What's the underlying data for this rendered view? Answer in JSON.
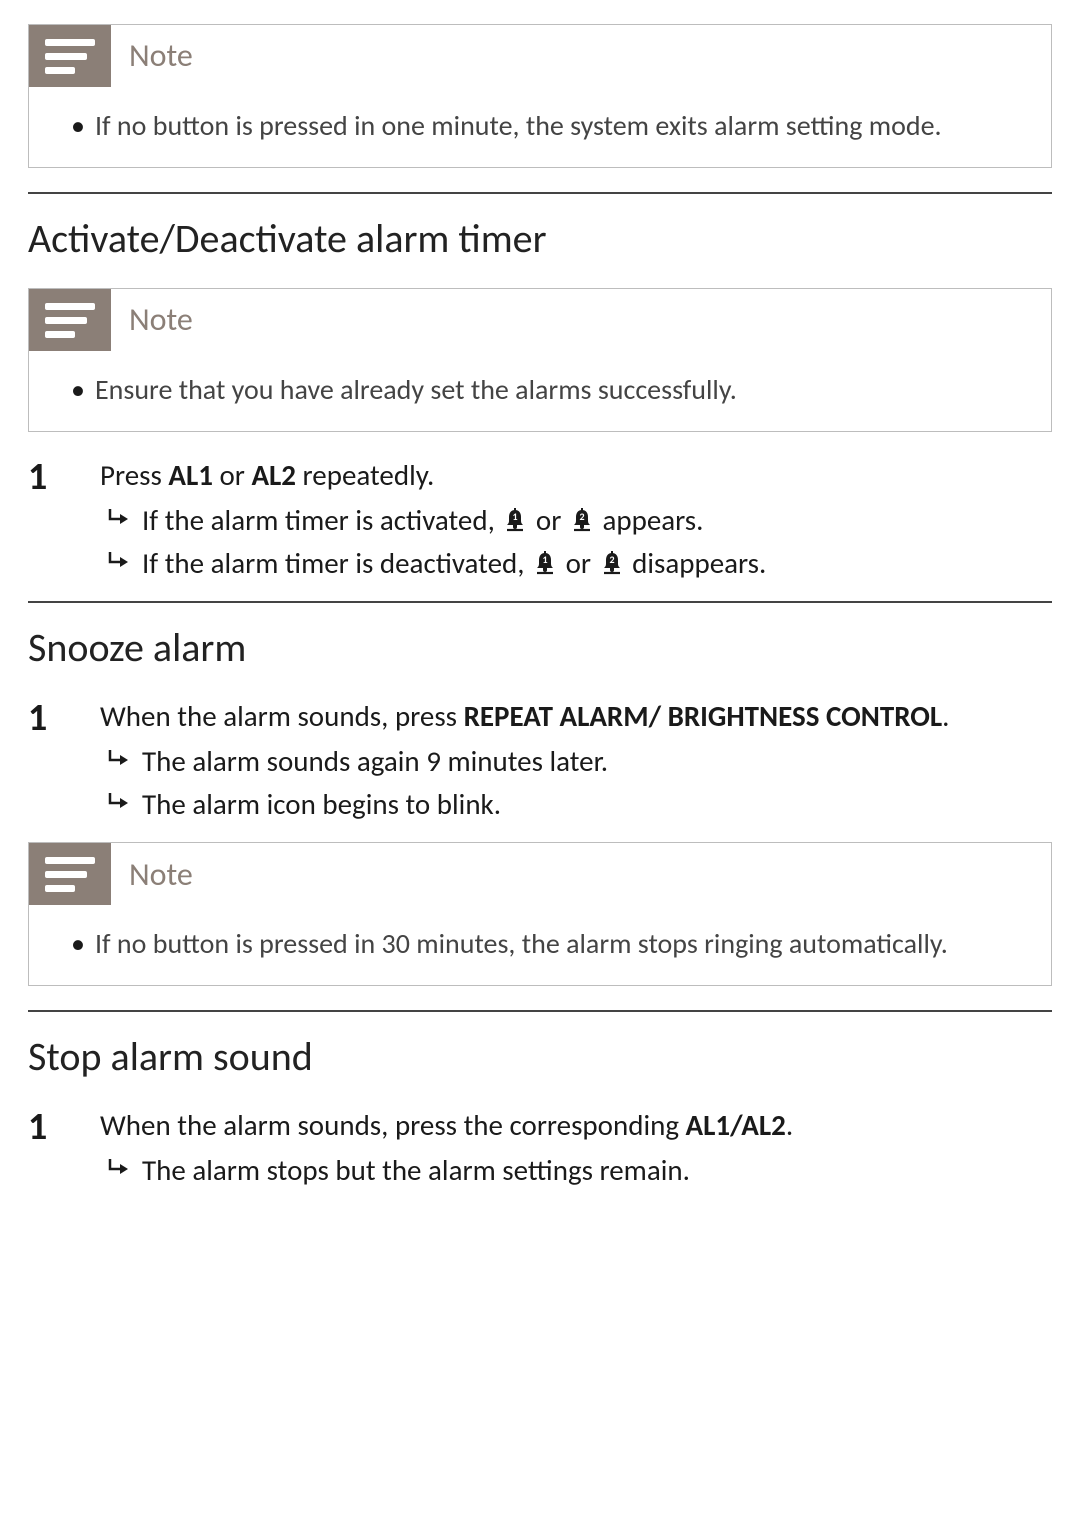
{
  "labels": {
    "note": "Note"
  },
  "note1": {
    "item1": "If no button is pressed in one minute, the system exits alarm setting mode."
  },
  "section_activate": {
    "title": "Activate/Deactivate alarm timer",
    "note_item1": "Ensure that you have already set the alarms successfully.",
    "step1_a": "Press ",
    "step1_b": "AL1",
    "step1_c": " or ",
    "step1_d": "AL2",
    "step1_e": " repeatedly.",
    "res1a_pre": "If the alarm timer is activated, ",
    "res1a_mid": " or ",
    "res1a_post": " appears.",
    "res1b_pre": "If the alarm timer is deactivated, ",
    "res1b_mid": " or ",
    "res1b_post": " disappears."
  },
  "section_snooze": {
    "title": "Snooze alarm",
    "step1_a": "When the alarm sounds, press ",
    "step1_b": "REPEAT ALARM/ BRIGHTNESS CONTROL",
    "step1_c": ".",
    "res1": "The alarm sounds again 9 minutes later.",
    "res2": "The alarm icon begins to blink.",
    "note_item1": "If no button is pressed in 30 minutes, the alarm stops ringing automatically."
  },
  "section_stop": {
    "title": "Stop alarm sound",
    "step1_a": "When the alarm sounds, press the corresponding ",
    "step1_b": "AL1/AL2",
    "step1_c": ".",
    "res1": "The alarm stops but the alarm settings remain."
  },
  "nums": {
    "one": "1"
  },
  "bells": {
    "one_label": "1",
    "two_label": "2"
  }
}
